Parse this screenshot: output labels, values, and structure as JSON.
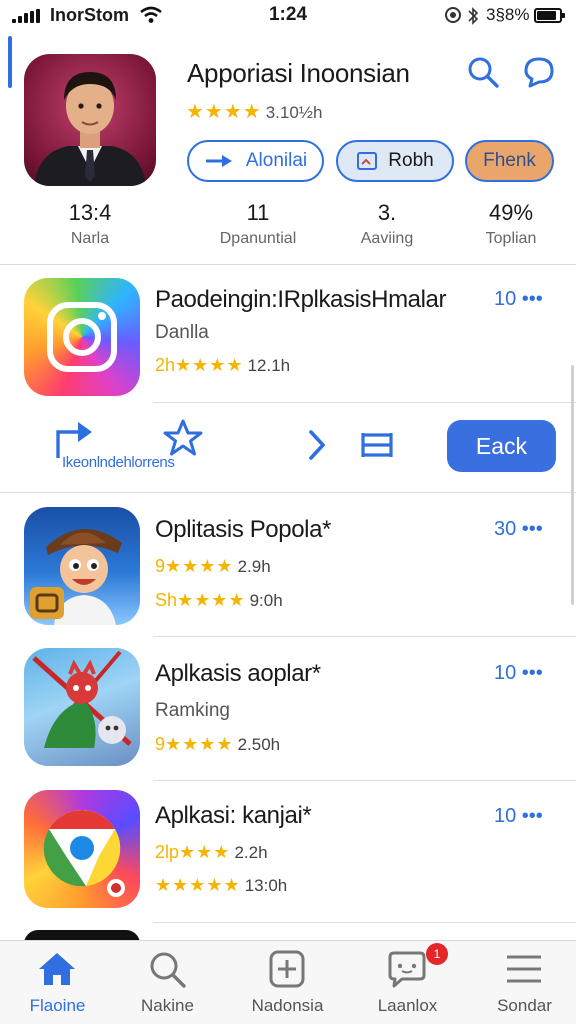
{
  "status_bar": {
    "carrier": "InorStom",
    "time": "1:24",
    "battery_text": "3§8%",
    "battery_level": 0.85
  },
  "header": {
    "app_title": "Apporiasi Inoonsian",
    "stars": "★★★★",
    "rating_count": "3.10½h",
    "search_icon": "search-icon",
    "chat_icon": "chat-icon"
  },
  "pills": {
    "a_label": "Alonilai",
    "b_label": "Robh",
    "c_label": "Fhenk"
  },
  "stats": [
    {
      "value": "13:4",
      "label": "Narla"
    },
    {
      "value": "11",
      "label": "Dpanuntial"
    },
    {
      "value": "3.",
      "label": "Aaviing"
    },
    {
      "value": "49%",
      "label": "Toplian"
    }
  ],
  "featured": {
    "title": "Paodeingin:IRplkasisHmalar",
    "subtitle": "Danlla",
    "rating_prefix": "2h",
    "stars": "★★★★",
    "rating_count": "12.1h",
    "action": "10 •••"
  },
  "strip": {
    "label": "Ikeonlndehlorrens",
    "back_label": "Eack"
  },
  "apps": [
    {
      "title": "Oplitasis Popola*",
      "line1_prefix": "9",
      "line1_stars": "★★★★",
      "line1_count": "2.9h",
      "line2_prefix": "Sh",
      "line2_stars": "★★★★",
      "line2_count": "9:0h",
      "action": "30 •••"
    },
    {
      "title": "Aplkasis aoplar*",
      "subtitle": "Ramking",
      "line2_prefix": "9",
      "line2_stars": "★★★★",
      "line2_count": "2.50h",
      "action": "10 •••"
    },
    {
      "title": "Aplkasi: kanjai*",
      "line1_prefix": "2lp",
      "line1_stars": "★★★",
      "line1_count": "2.2h",
      "line2_prefix": "",
      "line2_stars": "★★★★★",
      "line2_count": "13:0h",
      "action": "10 •••"
    }
  ],
  "tabs": [
    {
      "label": "Flaoine",
      "icon": "home-icon"
    },
    {
      "label": "Nakine",
      "icon": "search-icon"
    },
    {
      "label": "Nadonsia",
      "icon": "add-square-icon"
    },
    {
      "label": "Laanlox",
      "icon": "message-icon",
      "badge": "1"
    },
    {
      "label": "Sondar",
      "icon": "menu-icon"
    }
  ]
}
